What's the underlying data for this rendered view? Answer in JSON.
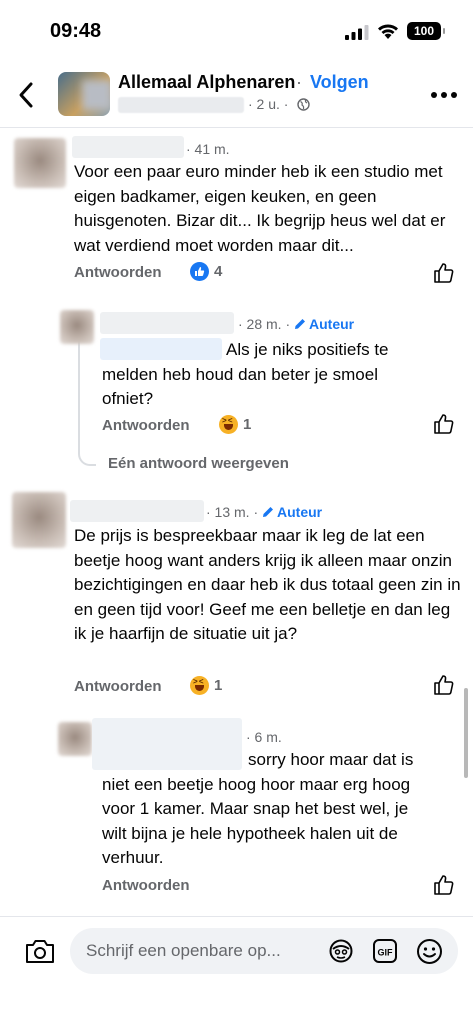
{
  "status_bar": {
    "time": "09:48",
    "battery": "100"
  },
  "header": {
    "group_name": "Allemaal Alphenaren",
    "separator": "·",
    "follow_label": "Volgen",
    "post_time": "· 2 u. ·"
  },
  "comments": [
    {
      "time": "· 41 m.",
      "text": "Voor een paar euro minder heb ik een studio met eigen badkamer, eigen keuken, en geen huisgenoten. Bizar dit... Ik begrijp heus wel dat er wat verdiend moet worden maar dit...",
      "reply_label": "Antwoorden",
      "reaction_count": "4"
    },
    {
      "time": "· 28 m. ·",
      "author_badge": "Auteur",
      "text": "Als je niks positiefs te melden heb houd dan beter je smoel ofniet?",
      "reply_label": "Antwoorden",
      "reaction_count": "1"
    },
    {
      "time": "· 13 m. ·",
      "author_badge": "Auteur",
      "text": "De prijs is bespreekbaar maar ik leg de lat een beetje hoog want anders krijg ik alleen maar onzin bezichtigingen en daar heb ik dus totaal geen zin in en geen tijd voor! Geef me een belletje en dan leg ik je haarfijn de situatie uit ja?",
      "reply_label": "Antwoorden",
      "reaction_count": "1"
    },
    {
      "time": "· 6 m.",
      "text": "sorry hoor maar dat is niet een beetje hoog hoor maar erg hoog voor 1 kamer. Maar snap het best wel, je wilt bijna je hele hypotheek halen uit de verhuur.",
      "reply_label": "Antwoorden"
    }
  ],
  "view_replies_label": "Eén antwoord weergeven",
  "composer": {
    "placeholder": "Schrijf een openbare op..."
  }
}
